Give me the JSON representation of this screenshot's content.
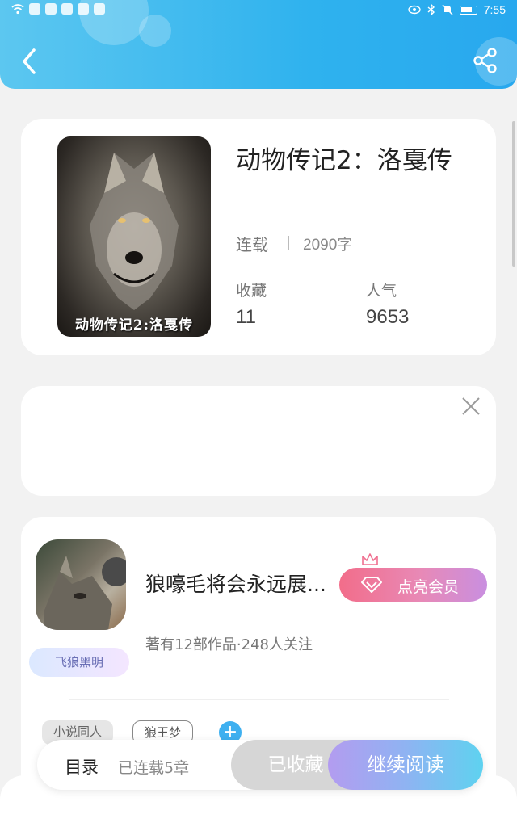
{
  "status_bar": {
    "time": "7:55"
  },
  "book": {
    "title": "动物传记2：洛戛传",
    "status": "连载",
    "word_count": "2090字",
    "cover_caption": "动物传记2:洛戛传",
    "collect_label": "收藏",
    "collect_value": "11",
    "popularity_label": "人气",
    "popularity_value": "9653"
  },
  "author": {
    "name": "狼嚎毛将会永远展...",
    "nameplate": "飞狼黑明",
    "summary": "著有12部作品·248人关注",
    "vip_label": "点亮会员",
    "tags": [
      "小说同人",
      "狼王梦"
    ],
    "add_tag": "+"
  },
  "bottom_bar": {
    "toc_label": "目录",
    "toc_sub": "已连载5章",
    "collected_label": "已收藏",
    "read_label": "继续阅读"
  },
  "colors": {
    "header_gradient_start": "#5cc7f0",
    "header_gradient_end": "#28a8ee",
    "vip_gradient_start": "#f26d8a",
    "vip_gradient_end": "#c98fe0",
    "read_gradient_start": "#b39cf0",
    "read_gradient_end": "#5ed2f0"
  },
  "icons": [
    "back-icon",
    "share-icon",
    "close-icon",
    "diamond-icon",
    "crown-icon",
    "plus-icon",
    "wifi-icon",
    "battery-icon"
  ]
}
